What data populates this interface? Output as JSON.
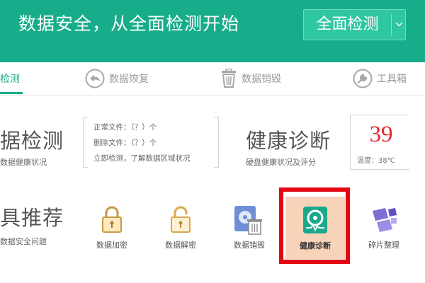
{
  "header": {
    "title": "数据安全，从全面检测开始",
    "scan_button": "全面检测"
  },
  "tabs": [
    {
      "label": "检测",
      "icon": "",
      "active": true
    },
    {
      "label": "数据恢复",
      "icon": "back-arrow-icon"
    },
    {
      "label": "数据销毁",
      "icon": "trash-icon"
    },
    {
      "label": "工具箱",
      "icon": "wrench-icon"
    }
  ],
  "data_check": {
    "title": "据检测",
    "subtitle": "数据健康状况",
    "lines": [
      "正常文件：（？）个",
      "删除文件：（？）个",
      "立即检测，了解数据区域状况"
    ]
  },
  "health": {
    "title": "健康诊断",
    "subtitle": "硬盘健康状况及评分",
    "temperature": "39",
    "temp_label": "温度：38℃"
  },
  "recommend": {
    "title": "具推荐",
    "subtitle": "数据安全问题"
  },
  "tools": [
    {
      "label": "数据加密",
      "icon": "lock-closed-icon"
    },
    {
      "label": "数据解密",
      "icon": "lock-open-icon"
    },
    {
      "label": "数据销毁",
      "icon": "disk-trash-icon"
    },
    {
      "label": "健康诊断",
      "icon": "health-disk-icon",
      "highlighted": true
    },
    {
      "label": "碎片整理",
      "icon": "defrag-icon"
    }
  ],
  "colors": {
    "brand": "#18ad8a",
    "temperature": "#e8222b",
    "highlight_border": "#e30613"
  }
}
